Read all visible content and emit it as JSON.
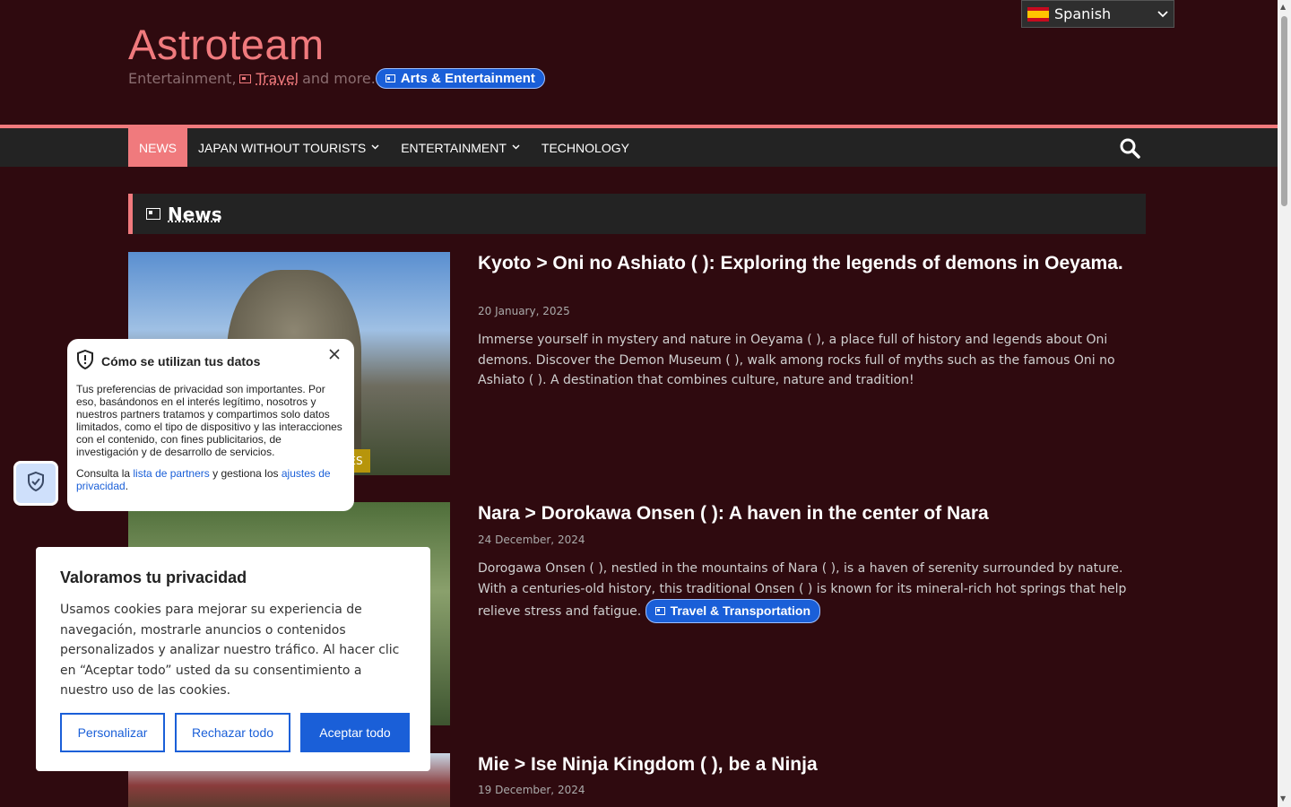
{
  "site": {
    "title": "Astroteam",
    "tagline_prefix": "Entertainment,",
    "tagline_link": "Travel",
    "tagline_suffix": "and more.",
    "tag_pill": "Arts & Entertainment"
  },
  "language": {
    "selected": "Spanish"
  },
  "nav": {
    "items": [
      {
        "label": "NEWS",
        "active": true,
        "dropdown": false
      },
      {
        "label": "JAPAN WITHOUT TOURISTS",
        "active": false,
        "dropdown": true
      },
      {
        "label": "ENTERTAINMENT",
        "active": false,
        "dropdown": true
      },
      {
        "label": "TECHNOLOGY",
        "active": false,
        "dropdown": false
      }
    ]
  },
  "section": {
    "title": "News"
  },
  "posts": [
    {
      "title": "Kyoto > Oni no Ashiato (        ): Exploring the legends of demons in Oeyama.",
      "date": "20 January, 2025",
      "excerpt": "Immerse yourself in mystery and nature in Oeyama (       ), a place full of history and legends about Oni demons. Discover the Demon Museum (                   ), walk among rocks full of myths such as the famous Oni no Ashiato (        ). A destination that combines culture, nature and tradition!",
      "badge": "CES"
    },
    {
      "title": "Nara > Dorokawa Onsen (        ): A haven in the center of Nara",
      "date": "24 December, 2024",
      "excerpt": "Dorogawa Onsen (        ), nestled in the mountains of Nara (       ), is a haven of serenity surrounded by nature. With a centuries-old history, this traditional Onsen (    ) is known for its mineral-rich hot springs that help relieve stress and fatigue.",
      "pill": "Travel & Transportation"
    },
    {
      "title": "Mie > Ise Ninja Kingdom (                   ), be a Ninja",
      "date": "19 December, 2024"
    }
  ],
  "data_popup": {
    "title": "Cómo se utilizan tus datos",
    "body": "Tus preferencias de privacidad son importantes. Por eso, basándonos en el interés legítimo, nosotros y nuestros partners tratamos y compartimos solo datos limitados, como el tipo de dispositivo y las interacciones con el contenido, con fines publicitarios, de investigación y de desarrollo de servicios.",
    "foot_prefix": "Consulta la",
    "partners_link": "lista de partners",
    "foot_middle": "y gestiona los",
    "settings_link": "ajustes de privacidad",
    "foot_suffix": "."
  },
  "cookie": {
    "title": "Valoramos tu privacidad",
    "text": "Usamos cookies para mejorar su experiencia de navegación, mostrarle anuncios o contenidos personalizados y analizar nuestro tráfico. Al hacer clic en “Aceptar todo” usted da su consentimiento a nuestro uso de las cookies.",
    "customize": "Personalizar",
    "reject": "Rechazar todo",
    "accept": "Aceptar todo"
  },
  "colors": {
    "background": "#2f0a0f",
    "accent": "#f07a7d",
    "primary_blue": "#1a5fd8"
  }
}
